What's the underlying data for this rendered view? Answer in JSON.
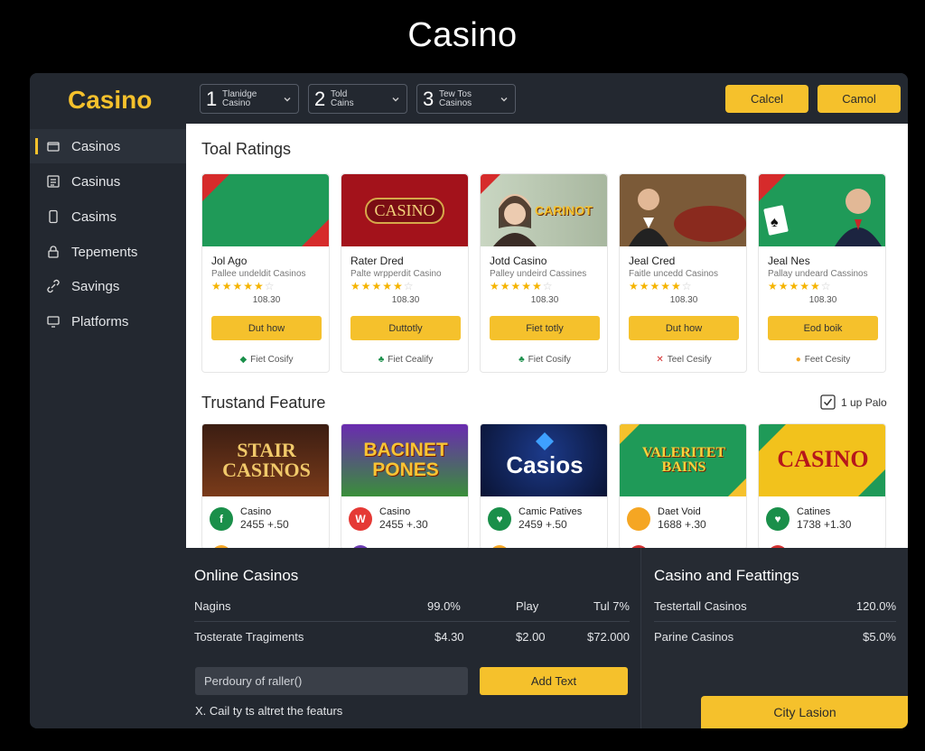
{
  "page_title": "Casino",
  "logo": "Casino",
  "selectors": [
    {
      "num": "1",
      "line1": "Tlanidge",
      "line2": "Casino"
    },
    {
      "num": "2",
      "line1": "Told",
      "line2": "Cains"
    },
    {
      "num": "3",
      "line1": "Tew Tos",
      "line2": "Casinos"
    }
  ],
  "top_buttons": [
    "Calcel",
    "Camol"
  ],
  "sidebar": {
    "items": [
      {
        "label": "Casinos",
        "icon": "wallet-icon",
        "active": true
      },
      {
        "label": "Casinus",
        "icon": "list-icon",
        "active": false
      },
      {
        "label": "Casims",
        "icon": "phone-icon",
        "active": false
      },
      {
        "label": "Tepements",
        "icon": "lock-icon",
        "active": false
      },
      {
        "label": "Savings",
        "icon": "link-icon",
        "active": false
      },
      {
        "label": "Platforms",
        "icon": "monitor-icon",
        "active": false
      }
    ]
  },
  "ratings": {
    "title": "Toal Ratings",
    "cards": [
      {
        "image_text": "",
        "name": "Jol Ago",
        "sub": "Pallee undeldit Casinos",
        "rating": 4,
        "value": "108.30",
        "button": "Dut how",
        "foot": "Fiet Cosify",
        "foot_mark": "◆",
        "foot_color": "#1a8f4a"
      },
      {
        "image_text": "CASINO",
        "name": "Rater Dred",
        "sub": "Palte wrpperdit Casino",
        "rating": 4,
        "value": "108.30",
        "button": "Duttotly",
        "foot": "Fiet Cealify",
        "foot_mark": "♣",
        "foot_color": "#1a8f4a"
      },
      {
        "image_text": "CARINOT",
        "name": "Jotd Casino",
        "sub": "Palley undeird Cassines",
        "rating": 4,
        "value": "108.30",
        "button": "Fiet totly",
        "foot": "Fiet Cosify",
        "foot_mark": "♣",
        "foot_color": "#1a8f4a"
      },
      {
        "image_text": "",
        "name": "Jeal Cred",
        "sub": "Faitle uncedd Casinos",
        "rating": 4,
        "value": "108.30",
        "button": "Dut how",
        "foot": "Teel Cesify",
        "foot_mark": "✕",
        "foot_color": "#d32f2f"
      },
      {
        "image_text": "",
        "name": "Jeal Nes",
        "sub": "Pallay undeard Cassinos",
        "rating": 4,
        "value": "108.30",
        "button": "Eod boik",
        "foot": "Feet Cesity",
        "foot_mark": "●",
        "foot_color": "#f5a623"
      }
    ]
  },
  "featured": {
    "title": "Trustand Feature",
    "checkbox_label": "1 up Palo",
    "cards": [
      {
        "image_line1": "STAIR",
        "image_line2": "CASINOS",
        "icon_letter": "f",
        "icon_color": "#1a8f4a",
        "t1": "Casino",
        "t2": "2455 +.50",
        "dot_color": "#f5a623"
      },
      {
        "image_line1": "BACINET",
        "image_line2": "PONES",
        "icon_letter": "W",
        "icon_color": "#e53935",
        "t1": "Casino",
        "t2": "2455 +.30",
        "dot_color": "#6a3ab2"
      },
      {
        "image_line1": "Casios",
        "image_line2": "",
        "icon_letter": "♥",
        "icon_color": "#1a8f4a",
        "t1": "Camic Patives",
        "t2": "2459 +.50",
        "dot_color": "#f5a623"
      },
      {
        "image_line1": "VALERITET",
        "image_line2": "BAINS",
        "icon_letter": "",
        "icon_color": "#f5a623",
        "t1": "Daet Void",
        "t2": "1688 +.30",
        "dot_color": "#d32f2f"
      },
      {
        "image_line1": "CASINO",
        "image_line2": "",
        "icon_letter": "♥",
        "icon_color": "#1a8f4a",
        "t1": "Catines",
        "t2": "1738 +1.30",
        "dot_color": "#d32f2f"
      }
    ]
  },
  "online_casinos": {
    "title": "Online Casinos",
    "rows": [
      {
        "c1": "Nagins",
        "c2": "99.0%",
        "c3": "Play",
        "c4": "Tul 7%"
      },
      {
        "c1": "Tosterate Tragiments",
        "c2": "$4.30",
        "c3": "$2.00",
        "c4": "$72.000"
      }
    ],
    "input_value": "Perdoury of raller()",
    "button": "Add Text",
    "note": "X. Cail ty ts altret the featurs"
  },
  "casino_features": {
    "title": "Casino and Feattings",
    "rows": [
      {
        "c1": "Testertall Casinos",
        "c2": "120.0%"
      },
      {
        "c1": "Parine Casinos",
        "c2": "$5.0%"
      }
    ],
    "button": "City Lasion"
  },
  "colors": {
    "accent": "#f5c12c",
    "dark": "#232830"
  }
}
